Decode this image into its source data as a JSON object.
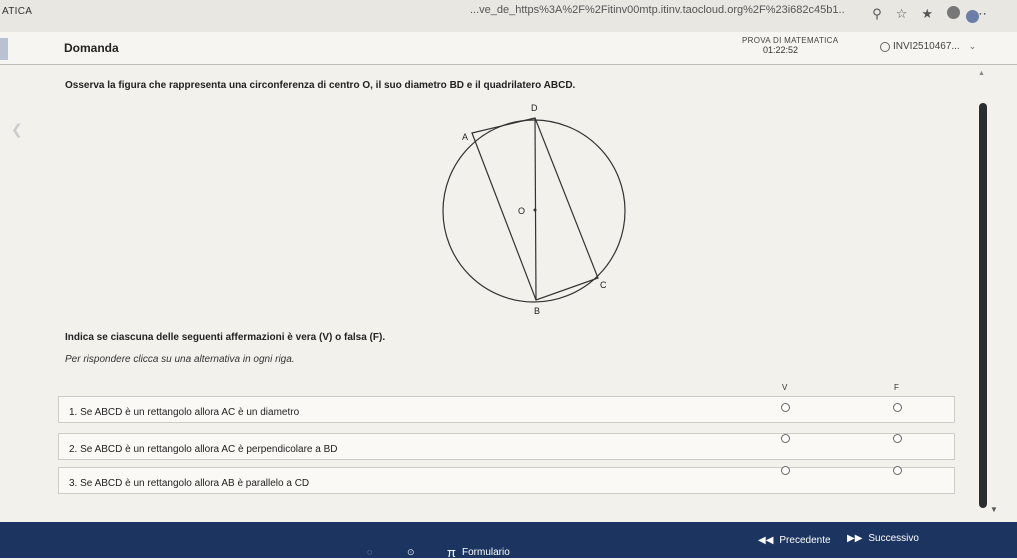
{
  "browser": {
    "tab_title": "ATICA",
    "url": "...ve_de_https%3A%2F%2Fitinv00mtp.itinv.taocloud.org%2F%23i682c45b1..."
  },
  "header": {
    "section_label": "Domanda",
    "test_name": "PROVA DI MATEMATICA",
    "timer": "01:22:52",
    "user_id": "INVI2510467..."
  },
  "question": {
    "prompt": "Osserva la figura che rappresenta una circonferenza di centro O, il suo diametro BD e il quadrilatero ABCD.",
    "figure_labels": {
      "A": "A",
      "B": "B",
      "C": "C",
      "D": "D",
      "O": "O"
    },
    "instruction": "Indica se ciascuna delle seguenti affermazioni è vera (V) o falsa (F).",
    "hint": "Per rispondere clicca su una alternativa in ogni riga.",
    "columns": {
      "true": "V",
      "false": "F"
    },
    "rows": [
      {
        "text": "1. Se ABCD è un rettangolo allora AC è un diametro"
      },
      {
        "text": "2. Se ABCD è un rettangolo allora AC è perpendicolare a BD"
      },
      {
        "text": "3. Se ABCD è un rettangolo allora AB è parallelo a CD"
      }
    ]
  },
  "footer": {
    "formulario": "Formulario",
    "previous": "Precedente",
    "next": "Successivo"
  },
  "colors": {
    "footer_bg": "#1c3560",
    "scroll_thumb": "#2b2d30"
  }
}
